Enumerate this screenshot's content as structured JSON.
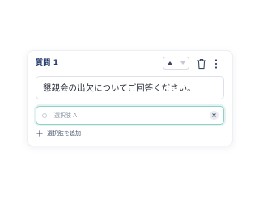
{
  "card": {
    "title": "質問 1",
    "question_text": "懇親会の出欠についてご回答ください。",
    "option": {
      "value": "",
      "placeholder": "選択肢 A"
    },
    "add_option_label": "選択肢を追加"
  },
  "icons": {
    "move_up": "chevron-up-icon",
    "move_down": "chevron-down-icon",
    "delete": "trash-icon",
    "more": "more-vertical-icon",
    "clear": "close-icon",
    "add": "plus-icon"
  },
  "colors": {
    "title": "#233a6b",
    "focus_border": "#8fd1c6",
    "text": "#2a2f3a",
    "muted": "#8a93a3"
  }
}
